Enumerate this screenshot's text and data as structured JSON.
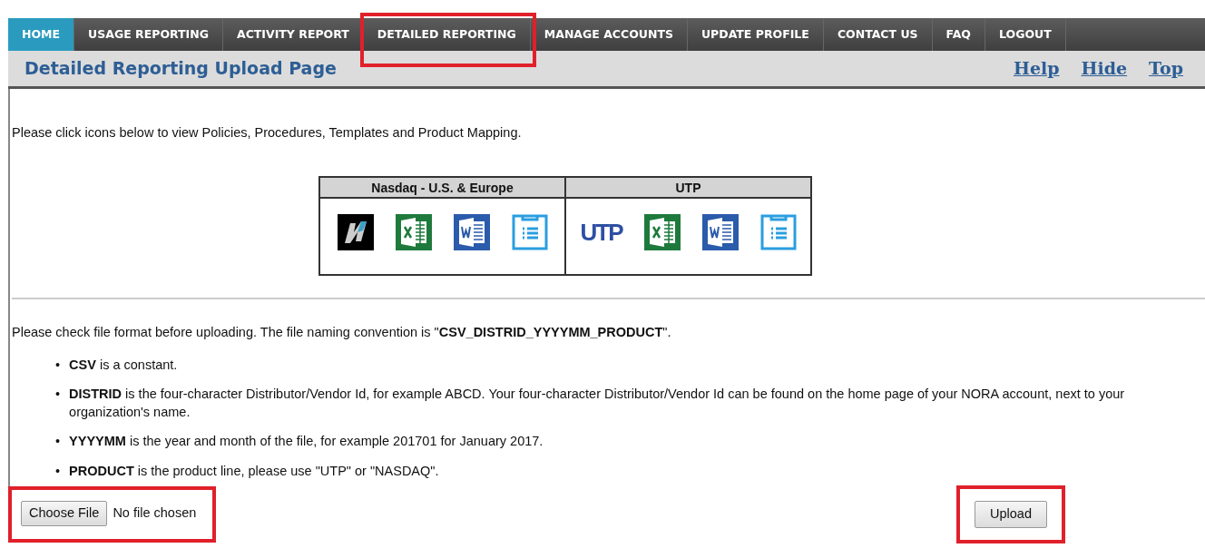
{
  "nav_tabs": [
    {
      "label": "HOME",
      "selected": true,
      "highlighted": false
    },
    {
      "label": "USAGE REPORTING",
      "selected": false,
      "highlighted": false
    },
    {
      "label": "ACTIVITY REPORT",
      "selected": false,
      "highlighted": false
    },
    {
      "label": "DETAILED REPORTING",
      "selected": false,
      "highlighted": true
    },
    {
      "label": "MANAGE ACCOUNTS",
      "selected": false,
      "highlighted": false
    },
    {
      "label": "UPDATE PROFILE",
      "selected": false,
      "highlighted": false
    },
    {
      "label": "CONTACT US",
      "selected": false,
      "highlighted": false
    },
    {
      "label": "FAQ",
      "selected": false,
      "highlighted": false
    },
    {
      "label": "LOGOUT",
      "selected": false,
      "highlighted": false
    }
  ],
  "page_title": "Detailed Reporting Upload Page",
  "header_links": [
    "Help",
    "Hide",
    "Top"
  ],
  "intro": "Please click icons below to view Policies, Procedures, Templates and Product Mapping.",
  "resource_groups": [
    {
      "title": "Nasdaq - U.S. & Europe",
      "icons": [
        {
          "kind": "logo"
        },
        {
          "kind": "excel"
        },
        {
          "kind": "word"
        },
        {
          "kind": "list"
        }
      ]
    },
    {
      "title": "UTP",
      "icons": [
        {
          "kind": "utp",
          "label": "UTP"
        },
        {
          "kind": "excel"
        },
        {
          "kind": "word"
        },
        {
          "kind": "list"
        }
      ]
    }
  ],
  "format_note": "Please check file format before uploading. The file naming convention is \"**CSV_DISTRID_YYYYMM_PRODUCT**\".",
  "rules": [
    {
      "marker": "•",
      "text": "**CSV** is a constant."
    },
    {
      "marker": "•",
      "text": "**DISTRID** is the four-character Distributor/Vendor Id, for example ABCD. Your four-character Distributor/Vendor Id can be found on the home page of your NORA account, next to your organization's name."
    },
    {
      "marker": "•",
      "text": "**YYYYMM** is the year and month of the file, for example 201701 for January 2017."
    },
    {
      "marker": "•",
      "text": "**PRODUCT** is the product line, please use \"UTP\" or \"NASDAQ\"."
    }
  ],
  "file_picker": {
    "button": "Choose File",
    "status": "No file chosen",
    "highlighted": true
  },
  "upload_button": {
    "label": "Upload",
    "highlighted": true
  }
}
